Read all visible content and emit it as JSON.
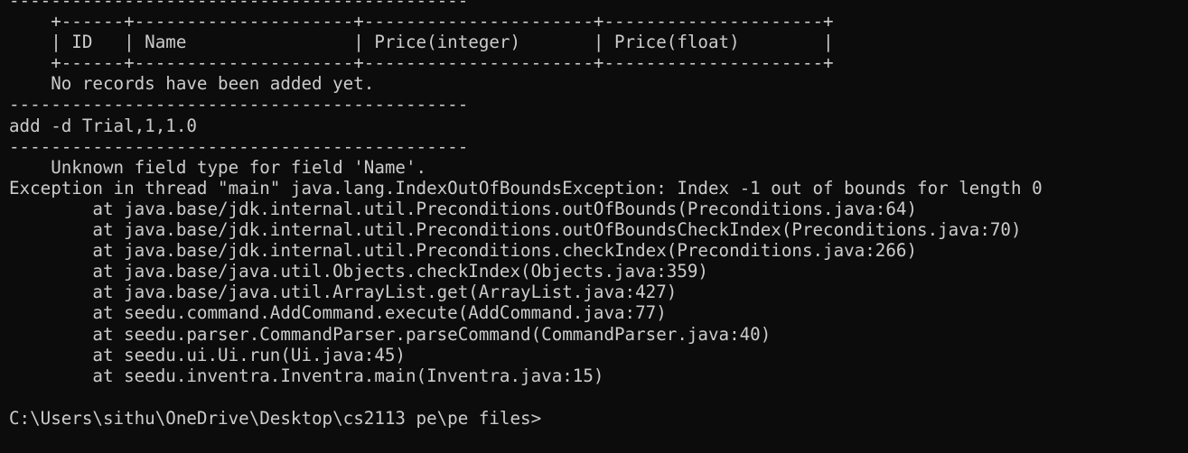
{
  "terminal": {
    "lines": [
      "--------------------------------------------",
      "    +------+---------------------+----------------------+---------------------+",
      "    | ID   | Name                | Price(integer)       | Price(float)        |",
      "    +------+---------------------+----------------------+---------------------+",
      "    No records have been added yet.",
      "--------------------------------------------",
      "add -d Trial,1,1.0",
      "--------------------------------------------",
      "    Unknown field type for field 'Name'.",
      "Exception in thread \"main\" java.lang.IndexOutOfBoundsException: Index -1 out of bounds for length 0",
      "        at java.base/jdk.internal.util.Preconditions.outOfBounds(Preconditions.java:64)",
      "        at java.base/jdk.internal.util.Preconditions.outOfBoundsCheckIndex(Preconditions.java:70)",
      "        at java.base/jdk.internal.util.Preconditions.checkIndex(Preconditions.java:266)",
      "        at java.base/java.util.Objects.checkIndex(Objects.java:359)",
      "        at java.base/java.util.ArrayList.get(ArrayList.java:427)",
      "        at seedu.command.AddCommand.execute(AddCommand.java:77)",
      "        at seedu.parser.CommandParser.parseCommand(CommandParser.java:40)",
      "        at seedu.ui.Ui.run(Ui.java:45)",
      "        at seedu.inventra.Inventra.main(Inventra.java:15)",
      "",
      "C:\\Users\\sithu\\OneDrive\\Desktop\\cs2113 pe\\pe files>"
    ]
  },
  "colors": {
    "background": "#0c0c0c",
    "foreground": "#cccccc"
  }
}
